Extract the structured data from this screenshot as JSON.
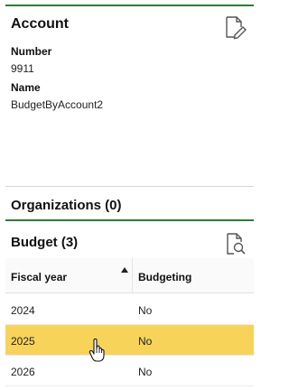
{
  "account": {
    "title": "Account",
    "number_label": "Number",
    "number_value": "9911",
    "name_label": "Name",
    "name_value": "BudgetByAccount2",
    "edit_icon": "edit-document-icon"
  },
  "organizations": {
    "title": "Organizations (0)"
  },
  "budget": {
    "title": "Budget (3)",
    "search_icon": "document-search-icon",
    "columns": [
      "Fiscal year",
      "Budgeting"
    ],
    "sort": "ascending",
    "rows": [
      {
        "fiscal_year": "2024",
        "budgeting": "No",
        "selected": false
      },
      {
        "fiscal_year": "2025",
        "budgeting": "No",
        "selected": true
      },
      {
        "fiscal_year": "2026",
        "budgeting": "No",
        "selected": false
      }
    ]
  },
  "colors": {
    "accent_green": "#2e7d32",
    "selected_row": "#f7d35a"
  }
}
